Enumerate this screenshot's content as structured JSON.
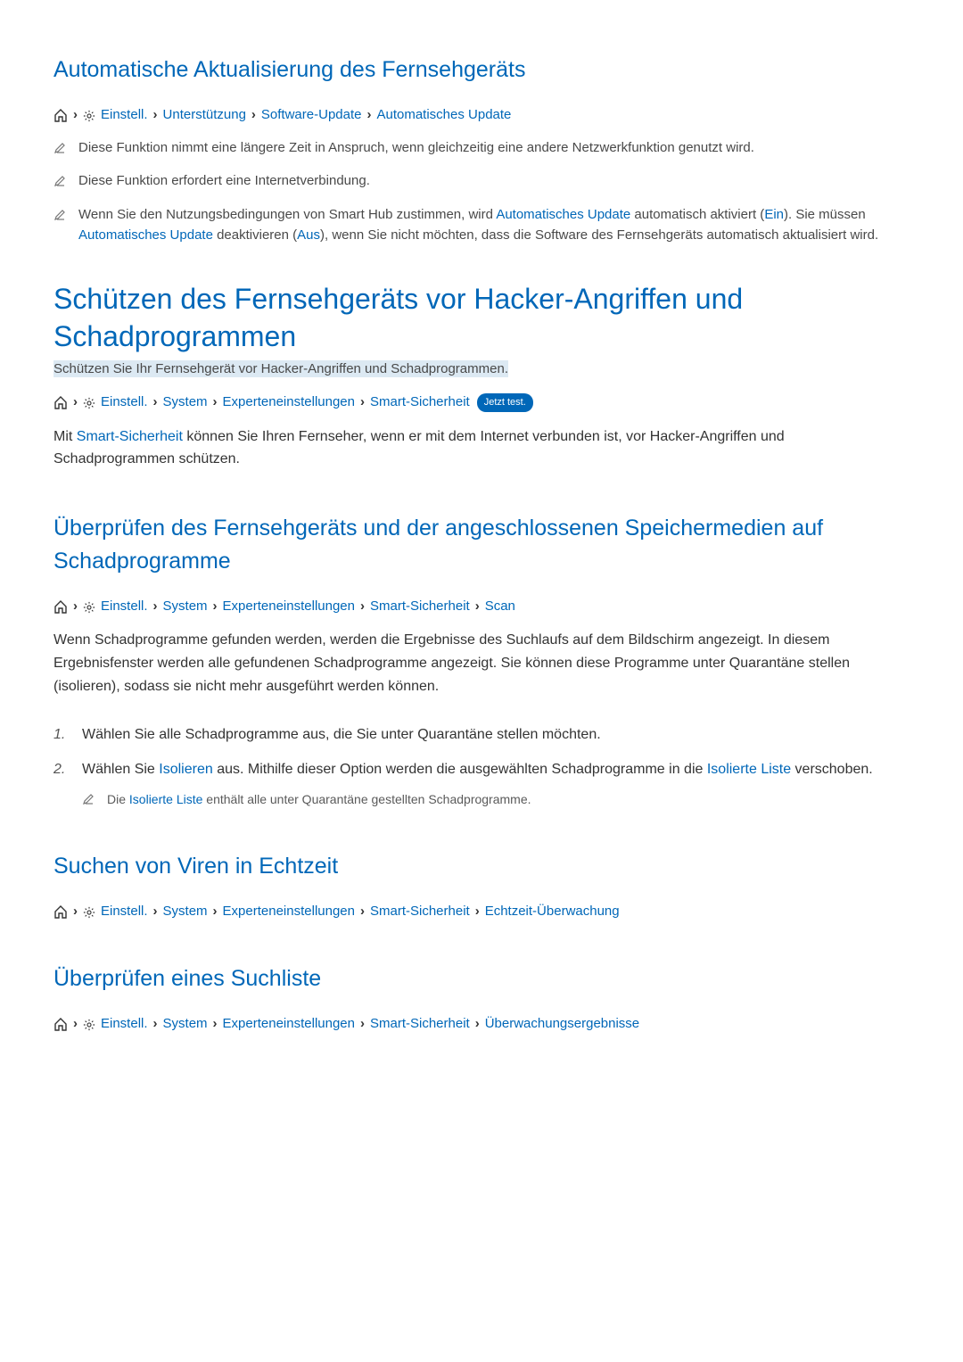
{
  "section1": {
    "title": "Automatische Aktualisierung des Fernsehgeräts",
    "breadcrumb": {
      "einstell": "Einstell.",
      "b2": "Unterstützung",
      "b3": "Software-Update",
      "b4": "Automatisches Update"
    },
    "notes": {
      "n1": "Diese Funktion nimmt eine längere Zeit in Anspruch, wenn gleichzeitig eine andere Netzwerkfunktion genutzt wird.",
      "n2": "Diese Funktion erfordert eine Internetverbindung.",
      "n3_pre": "Wenn Sie den Nutzungsbedingungen von Smart Hub zustimmen, wird ",
      "n3_em1": "Automatisches Update",
      "n3_mid1": " automatisch aktiviert (",
      "n3_em2": "Ein",
      "n3_mid2": "). Sie müssen ",
      "n3_em3": "Automatisches Update",
      "n3_mid3": " deaktivieren (",
      "n3_em4": "Aus",
      "n3_end": "), wenn Sie nicht möchten, dass die Software des Fernsehgeräts automatisch aktualisiert wird."
    }
  },
  "section2": {
    "title": "Schützen des Fernsehgeräts vor Hacker-Angriffen und Schadprogrammen",
    "subtitle": "Schützen Sie Ihr Fernsehgerät vor Hacker-Angriffen und Schadprogrammen.",
    "breadcrumb": {
      "einstell": "Einstell.",
      "b2": "System",
      "b3": "Experteneinstellungen",
      "b4": "Smart-Sicherheit",
      "badge": "Jetzt test."
    },
    "body_pre": "Mit ",
    "body_em": "Smart-Sicherheit",
    "body_post": " können Sie Ihren Fernseher, wenn er mit dem Internet verbunden ist, vor Hacker-Angriffen und Schadprogrammen schützen."
  },
  "section3": {
    "title": "Überprüfen des Fernsehgeräts und der angeschlossenen Speichermedien auf Schadprogramme",
    "breadcrumb": {
      "einstell": "Einstell.",
      "b2": "System",
      "b3": "Experteneinstellungen",
      "b4": "Smart-Sicherheit",
      "b5": "Scan"
    },
    "body": "Wenn Schadprogramme gefunden werden, werden die Ergebnisse des Suchlaufs auf dem Bildschirm angezeigt. In diesem Ergebnisfenster werden alle gefundenen Schadprogramme angezeigt. Sie können diese Programme unter Quarantäne stellen (isolieren), sodass sie nicht mehr ausgeführt werden können.",
    "steps": {
      "s1": "Wählen Sie alle Schadprogramme aus, die Sie unter Quarantäne stellen möchten.",
      "s2_pre": "Wählen Sie ",
      "s2_em1": "Isolieren",
      "s2_mid": " aus. Mithilfe dieser Option werden die ausgewählten Schadprogramme in die ",
      "s2_em2": "Isolierte Liste",
      "s2_end": " verschoben.",
      "subnote_pre": "Die ",
      "subnote_em": "Isolierte Liste",
      "subnote_post": " enthält alle unter Quarantäne gestellten Schadprogramme."
    }
  },
  "section4": {
    "title": "Suchen von Viren in Echtzeit",
    "breadcrumb": {
      "einstell": "Einstell.",
      "b2": "System",
      "b3": "Experteneinstellungen",
      "b4": "Smart-Sicherheit",
      "b5": "Echtzeit-Überwachung"
    }
  },
  "section5": {
    "title": "Überprüfen eines Suchliste",
    "breadcrumb": {
      "einstell": "Einstell.",
      "b2": "System",
      "b3": "Experteneinstellungen",
      "b4": "Smart-Sicherheit",
      "b5": "Überwachungsergebnisse"
    }
  }
}
